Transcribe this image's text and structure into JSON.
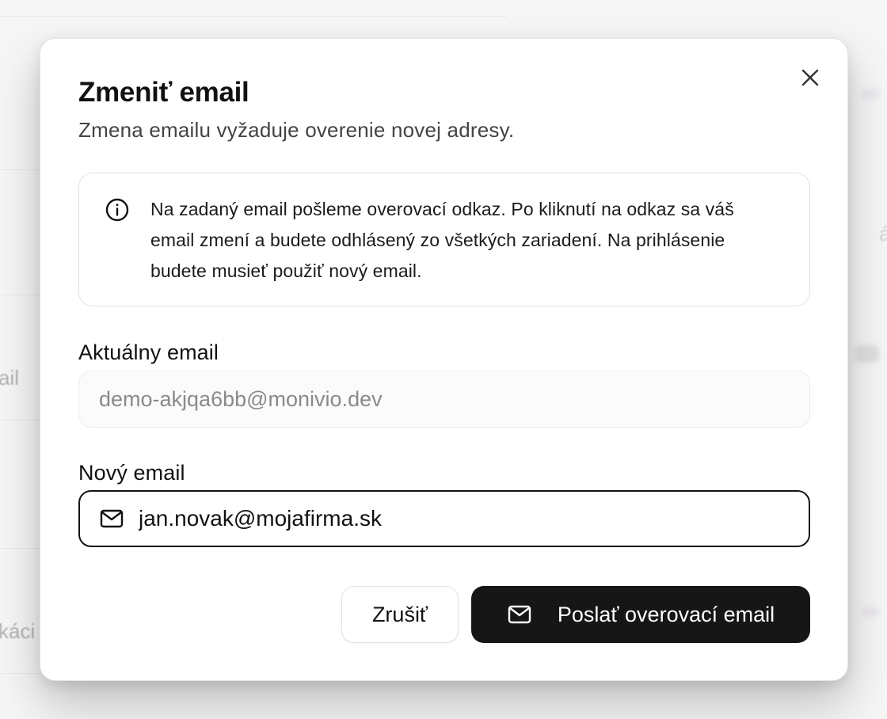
{
  "background": {
    "fragments": [
      "ail",
      "káci",
      "á"
    ]
  },
  "dialog": {
    "title": "Zmeniť email",
    "subtitle": "Zmena emailu vyžaduje overenie novej adresy.",
    "info_text": "Na zadaný email pošleme overovací odkaz. Po kliknutí na odkaz sa váš email zmení a budete odhlásený zo všetkých zariadení. Na prihlásenie budete musieť použiť nový email.",
    "current_email": {
      "label": "Aktuálny email",
      "value": "demo-akjqa6bb@monivio.dev"
    },
    "new_email": {
      "label": "Nový email",
      "value": "jan.novak@mojafirma.sk"
    },
    "cancel_label": "Zrušiť",
    "submit_label": "Poslať overovací email"
  },
  "colors": {
    "primary_button": "#161616",
    "focus_border": "#141414",
    "muted_text": "#8a8a8a"
  },
  "icons": {
    "close": "close-icon",
    "info": "info-icon",
    "mail": "mail-icon"
  }
}
